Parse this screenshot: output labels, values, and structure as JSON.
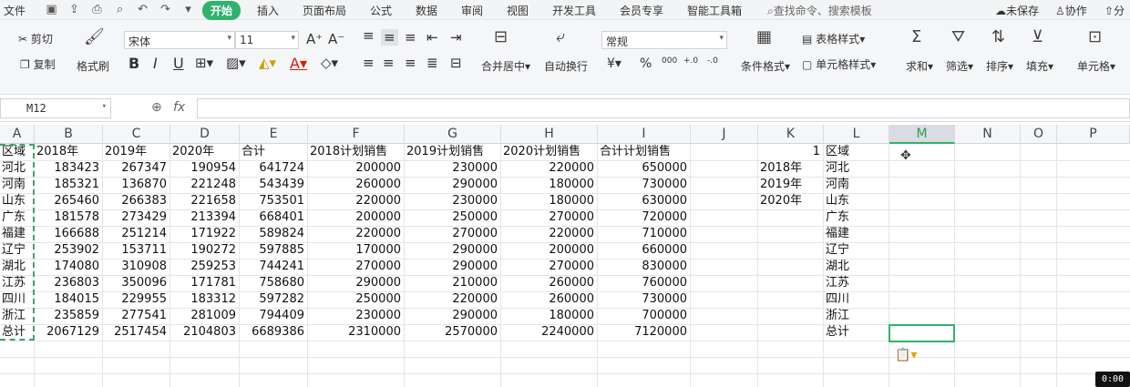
{
  "menubar": {
    "file": "文件",
    "tabs": [
      "开始",
      "插入",
      "页面布局",
      "公式",
      "数据",
      "审阅",
      "视图",
      "开发工具",
      "会员专享",
      "智能工具箱"
    ],
    "search": "查找命令、搜索模板",
    "unsaved": "未保存",
    "collab": "协作",
    "share": "分"
  },
  "ribbon": {
    "cut": "剪切",
    "copy": "复制",
    "format_painter": "格式刷",
    "font_name": "宋体",
    "font_size": "11",
    "number_format": "常规",
    "merge_center": "合并居中",
    "wrap_text": "自动换行",
    "cond_format": "条件格式",
    "table_style": "表格样式",
    "cell_style": "单元格样式",
    "sum": "求和",
    "filter": "筛选",
    "sort": "排序",
    "fill": "填充",
    "cell": "单元格",
    "bold": "B",
    "italic": "I",
    "underline": "U",
    "currency": "¥",
    "percent": "%",
    "thousand": "000",
    "dec_inc": "+.0",
    "dec_dec": "-.0",
    "fx": "fx"
  },
  "formula": {
    "namebox": "M12",
    "content": ""
  },
  "columns": [
    "A",
    "B",
    "C",
    "D",
    "E",
    "F",
    "G",
    "H",
    "I",
    "J",
    "K",
    "L",
    "M",
    "N",
    "O",
    "P"
  ],
  "table": {
    "headers": [
      "区域",
      "2018年",
      "2019年",
      "2020年",
      "合计",
      "2018计划销售",
      "2019计划销售",
      "2020计划销售",
      "合计计划销售"
    ],
    "rows": [
      [
        "河北",
        "183423",
        "267347",
        "190954",
        "641724",
        "200000",
        "230000",
        "220000",
        "650000"
      ],
      [
        "河南",
        "185321",
        "136870",
        "221248",
        "543439",
        "260000",
        "290000",
        "180000",
        "730000"
      ],
      [
        "山东",
        "265460",
        "266383",
        "221658",
        "753501",
        "220000",
        "230000",
        "180000",
        "630000"
      ],
      [
        "广东",
        "181578",
        "273429",
        "213394",
        "668401",
        "200000",
        "250000",
        "270000",
        "720000"
      ],
      [
        "福建",
        "166688",
        "251214",
        "171922",
        "589824",
        "220000",
        "270000",
        "220000",
        "710000"
      ],
      [
        "辽宁",
        "253902",
        "153711",
        "190272",
        "597885",
        "170000",
        "290000",
        "200000",
        "660000"
      ],
      [
        "湖北",
        "174080",
        "310908",
        "259253",
        "744241",
        "270000",
        "290000",
        "270000",
        "830000"
      ],
      [
        "江苏",
        "236803",
        "350096",
        "171781",
        "758680",
        "290000",
        "210000",
        "260000",
        "760000"
      ],
      [
        "四川",
        "184015",
        "229955",
        "183312",
        "597282",
        "250000",
        "220000",
        "260000",
        "730000"
      ],
      [
        "浙江",
        "235859",
        "277541",
        "281009",
        "794409",
        "230000",
        "290000",
        "180000",
        "700000"
      ],
      [
        "总计",
        "2067129",
        "2517454",
        "2104803",
        "6689386",
        "2310000",
        "2570000",
        "2240000",
        "7120000"
      ]
    ]
  },
  "side": {
    "k": [
      "1",
      "2018年",
      "2019年",
      "2020年"
    ],
    "l": [
      "区域",
      "河北",
      "河南",
      "山东",
      "广东",
      "福建",
      "辽宁",
      "湖北",
      "江苏",
      "四川",
      "浙江",
      "总计"
    ]
  },
  "timer": "0:00"
}
